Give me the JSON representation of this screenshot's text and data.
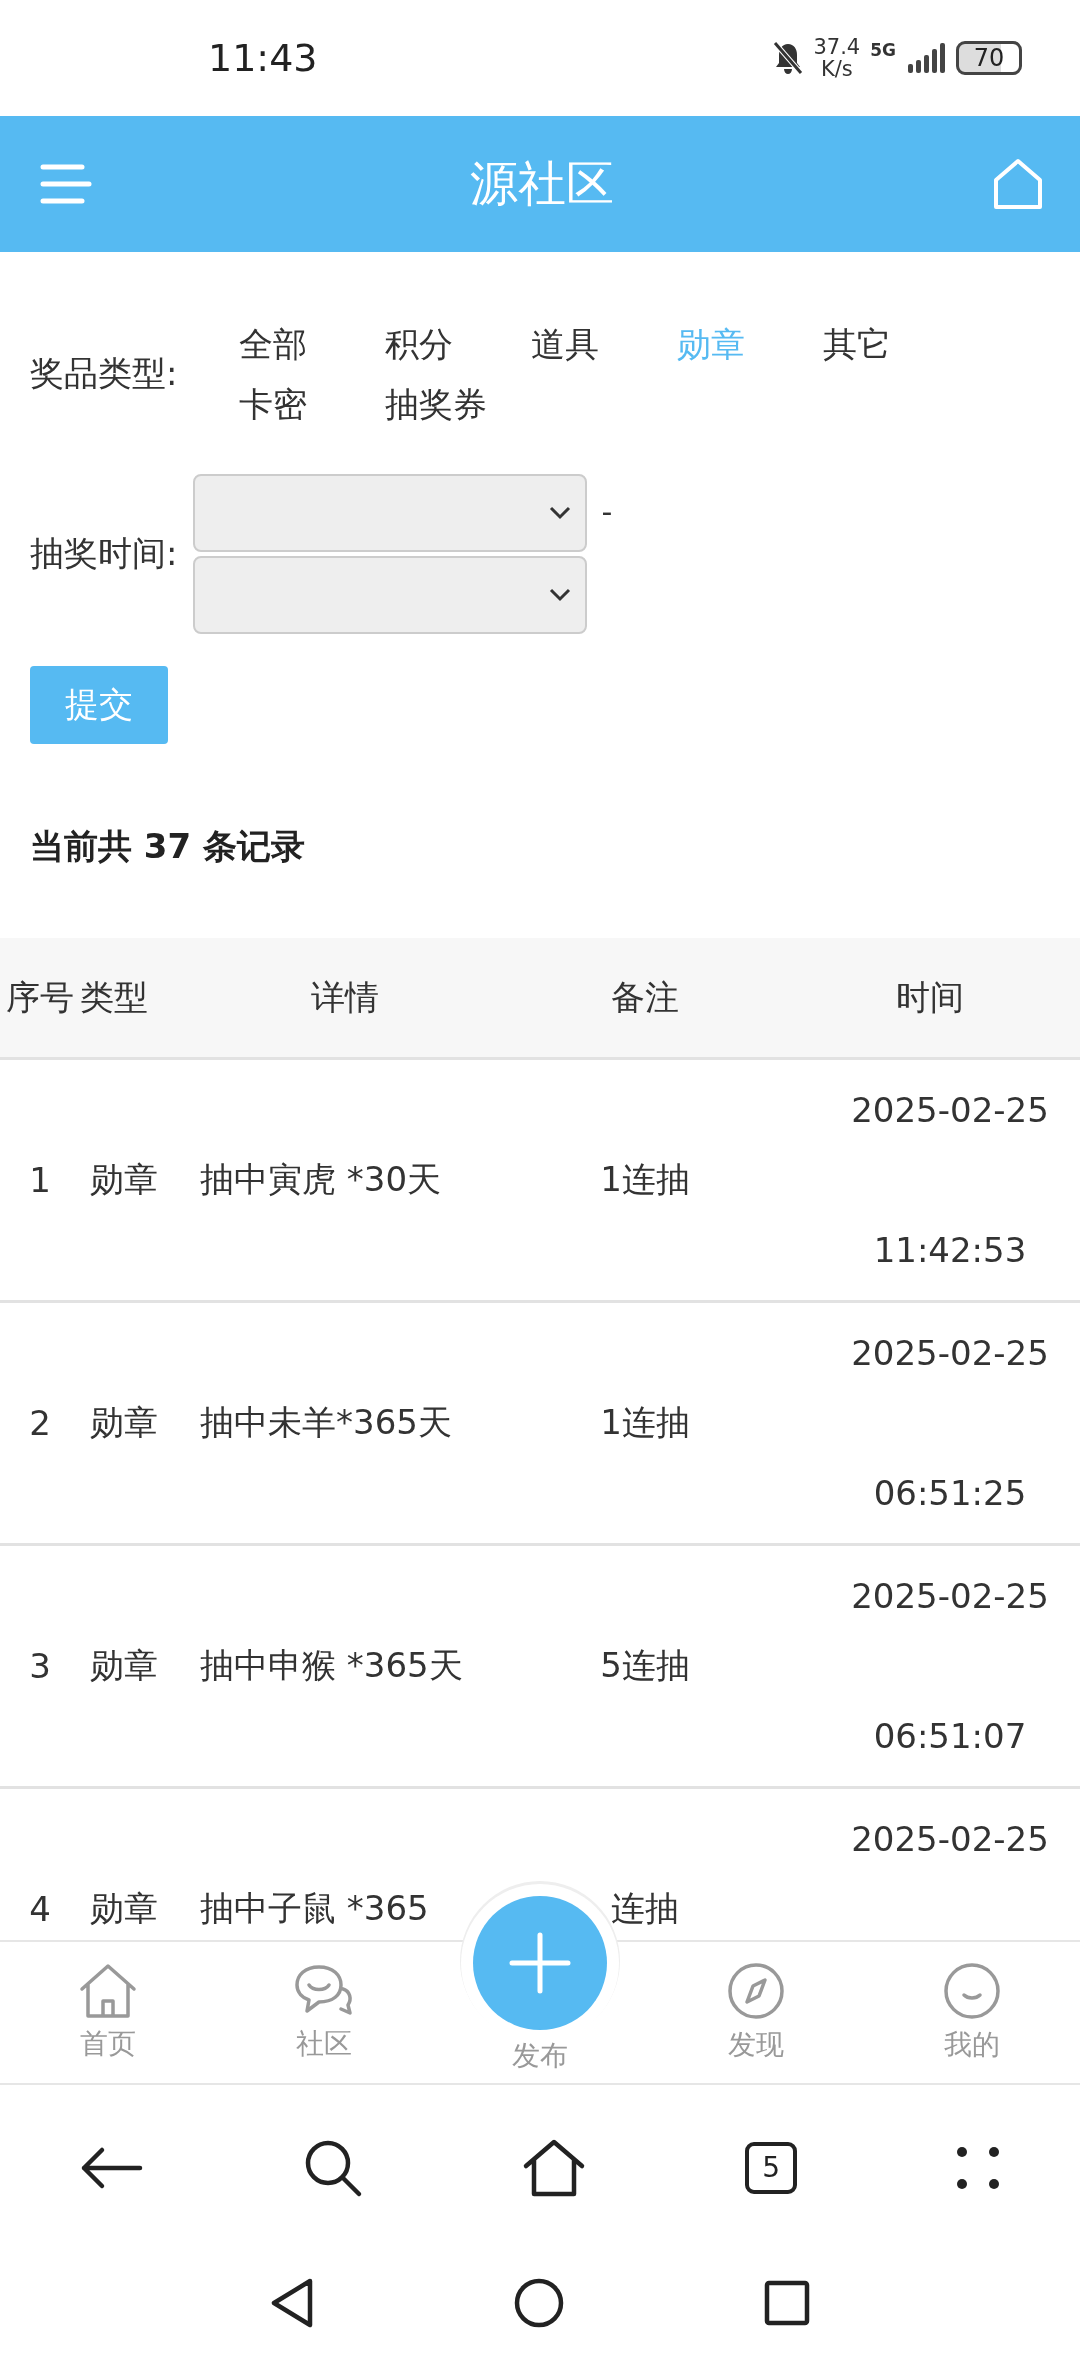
{
  "status_bar": {
    "time": "11:43",
    "net_speed": "37.4",
    "net_unit": "K/s",
    "network": "5G",
    "battery": "70"
  },
  "header": {
    "title": "源社区"
  },
  "prize_filter": {
    "label": "奖品类型:",
    "options": [
      {
        "label": "全部",
        "selected": false
      },
      {
        "label": "积分",
        "selected": false
      },
      {
        "label": "道具",
        "selected": false
      },
      {
        "label": "勋章",
        "selected": true
      },
      {
        "label": "其它",
        "selected": false
      },
      {
        "label": "卡密",
        "selected": false
      },
      {
        "label": "抽奖券",
        "selected": false
      }
    ]
  },
  "time_filter": {
    "label": "抽奖时间:",
    "separator": "-"
  },
  "submit": "提交",
  "summary": "当前共 37 条记录",
  "table": {
    "columns": [
      "序号",
      "类型",
      "详情",
      "备注",
      "时间"
    ],
    "rows": [
      {
        "index": "1",
        "type": "勋章",
        "detail": "抽中寅虎 *30天",
        "remark": "1连抽",
        "date": "2025-02-25",
        "time": "11:42:53"
      },
      {
        "index": "2",
        "type": "勋章",
        "detail": "抽中未羊*365天",
        "remark": "1连抽",
        "date": "2025-02-25",
        "time": "06:51:25"
      },
      {
        "index": "3",
        "type": "勋章",
        "detail": "抽中申猴 *365天",
        "remark": "5连抽",
        "date": "2025-02-25",
        "time": "06:51:07"
      },
      {
        "index": "4",
        "type": "勋章",
        "detail": "抽中子鼠 *365",
        "remark": "连抽",
        "date": "2025-02-25"
      }
    ]
  },
  "bottom_nav": [
    {
      "kind": "home",
      "label": "首页"
    },
    {
      "kind": "chat",
      "label": "社区"
    },
    {
      "kind": "fab",
      "label": "发布"
    },
    {
      "kind": "compass",
      "label": "发现"
    },
    {
      "kind": "smile",
      "label": "我的"
    }
  ],
  "browser_bar": {
    "tab_count": "5"
  }
}
